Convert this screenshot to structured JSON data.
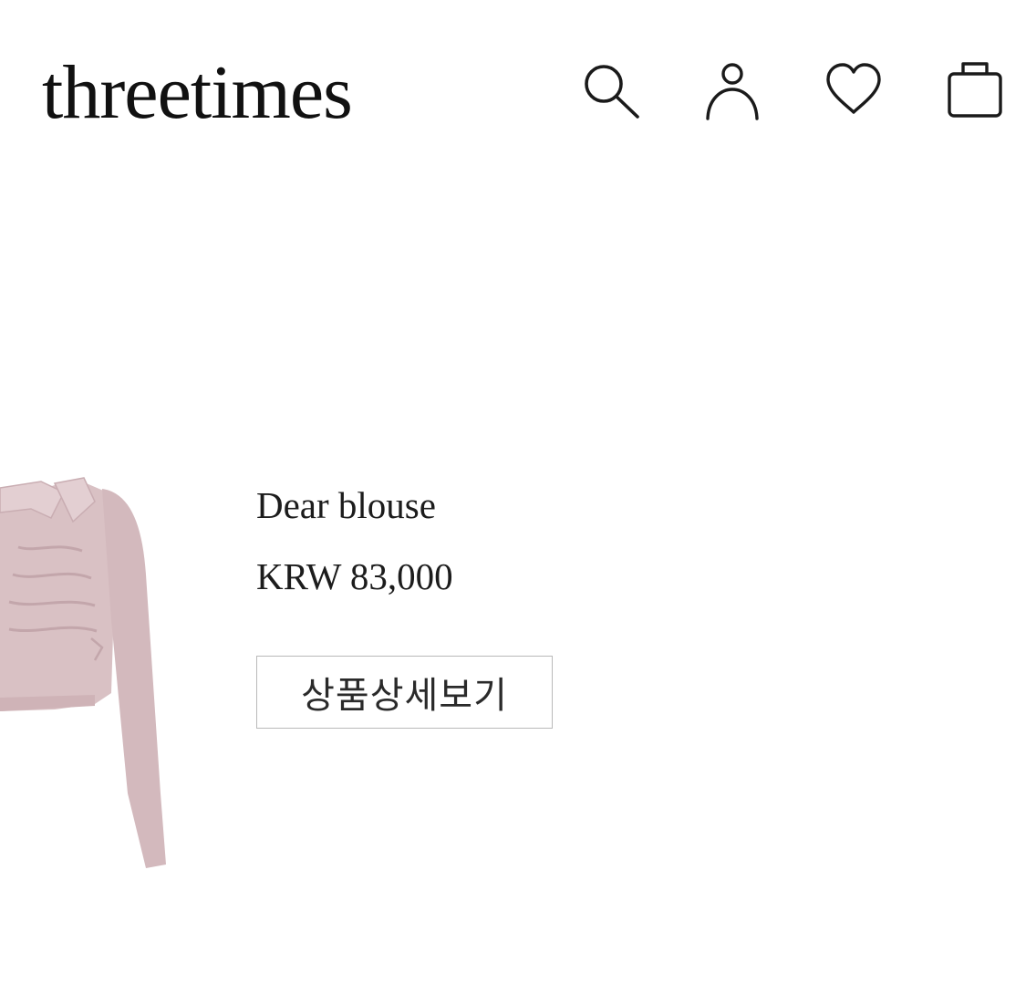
{
  "header": {
    "logo": "threetimes",
    "icons": [
      {
        "name": "search-icon"
      },
      {
        "name": "account-icon"
      },
      {
        "name": "heart-icon"
      },
      {
        "name": "shopping-bag-icon"
      }
    ]
  },
  "product": {
    "name": "Dear blouse",
    "price": "KRW 83,000",
    "detail_button_label": "상품상세보기",
    "image": {
      "name": "pink-blouse-image",
      "color": "#d9c1c4"
    }
  },
  "colors": {
    "text": "#1a1a1a",
    "button_border": "#b9b9b9",
    "background": "#ffffff"
  }
}
